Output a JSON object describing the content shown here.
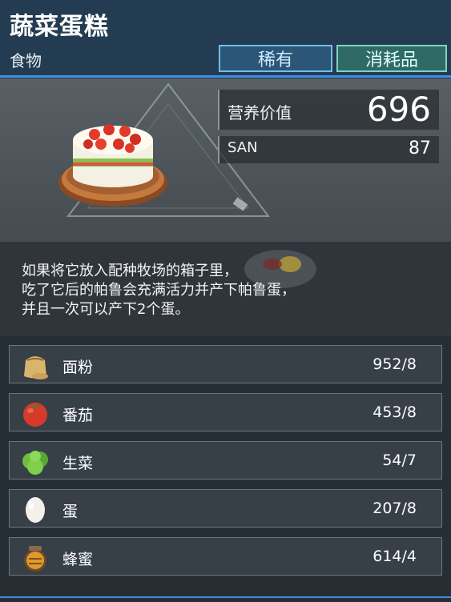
{
  "item": {
    "name": "蔬菜蛋糕",
    "category": "食物",
    "rarity": "稀有",
    "type": "消耗品"
  },
  "stats": {
    "nutrition_label": "营养价值",
    "nutrition_value": "696",
    "san_label": "SAN",
    "san_value": "87"
  },
  "description": [
    "如果将它放入配种牧场的箱子里，",
    "吃了它后的帕鲁会充满活力并产下帕鲁蛋，",
    "并且一次可以产下2个蛋。"
  ],
  "ingredients": [
    {
      "name": "面粉",
      "count": "952/8",
      "icon": "flour-bag-icon"
    },
    {
      "name": "番茄",
      "count": "453/8",
      "icon": "tomato-icon"
    },
    {
      "name": "生菜",
      "count": "54/7",
      "icon": "lettuce-icon"
    },
    {
      "name": "蛋",
      "count": "207/8",
      "icon": "egg-icon"
    },
    {
      "name": "蜂蜜",
      "count": "614/4",
      "icon": "honey-jar-icon"
    }
  ],
  "colors": {
    "header_bg": "#243c52",
    "accent_blue": "#3f8fe3",
    "rarity_tag": "#2b5677",
    "type_tag": "#2f6a66"
  }
}
